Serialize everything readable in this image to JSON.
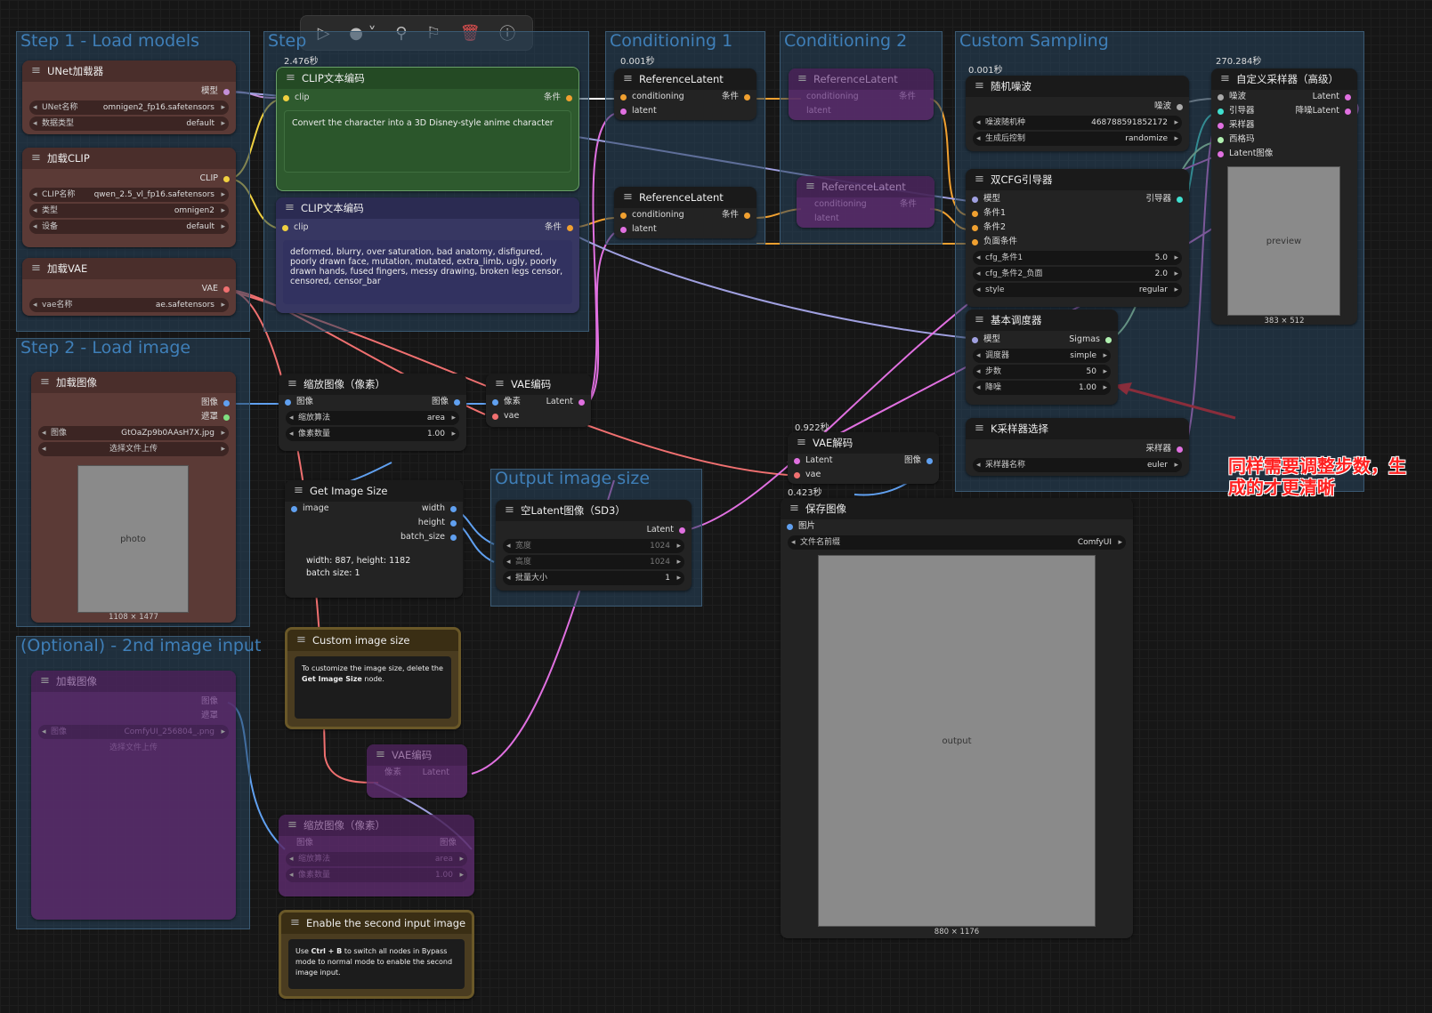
{
  "toolbar": {
    "play_icon": "play-icon",
    "record_icon": "record-icon",
    "link_icon": "link-icon",
    "pin_icon": "pin-icon",
    "delete_icon": "trash-icon",
    "help_icon": "help-icon",
    "delete_color": "#e05050"
  },
  "groups": {
    "step1": "Step 1 - Load models",
    "step": "Step",
    "cond1": "Conditioning 1",
    "cond2": "Conditioning 2",
    "custom": "Custom Sampling",
    "step2": "Step 2 - Load image",
    "output": "Output image size",
    "optional": "(Optional) - 2nd image input"
  },
  "times": {
    "clip1": "2.476秒",
    "cond1": "0.001秒",
    "noise": "0.001秒",
    "sampler": "270.284秒",
    "vaedec": "0.922秒",
    "save": "0.423秒"
  },
  "unet": {
    "title": "UNet加载器",
    "out": "模型",
    "w1_label": "UNet名称",
    "w1_value": "omnigen2_fp16.safetensors",
    "w2_label": "数据类型",
    "w2_value": "default"
  },
  "clip": {
    "title": "加载CLIP",
    "out": "CLIP",
    "w1_label": "CLIP名称",
    "w1_value": "qwen_2.5_vl_fp16.safetensors",
    "w2_label": "类型",
    "w2_value": "omnigen2",
    "w3_label": "设备",
    "w3_value": "default"
  },
  "vae": {
    "title": "加载VAE",
    "out": "VAE",
    "w1_label": "vae名称",
    "w1_value": "ae.safetensors"
  },
  "clipText1": {
    "title": "CLIP文本编码",
    "in": "clip",
    "out": "条件",
    "text": "Convert the character into a 3D Disney-style anime character"
  },
  "clipText2": {
    "title": "CLIP文本编码",
    "in": "clip",
    "out": "条件",
    "text": "deformed, blurry, over saturation, bad anatomy, disfigured, poorly drawn face, mutation, mutated, extra_limb, ugly, poorly drawn hands, fused fingers, messy drawing, broken legs censor, censored, censor_bar"
  },
  "ref1": {
    "title": "ReferenceLatent",
    "in1": "conditioning",
    "in2": "latent",
    "out": "条件"
  },
  "ref2": {
    "title": "ReferenceLatent",
    "in1": "conditioning",
    "in2": "latent",
    "out": "条件"
  },
  "ref3": {
    "title": "ReferenceLatent",
    "in1": "conditioning",
    "in2": "latent",
    "out": "条件"
  },
  "ref4": {
    "title": "ReferenceLatent",
    "in1": "conditioning",
    "in2": "latent",
    "out": "条件"
  },
  "noise": {
    "title": "随机噪波",
    "out": "噪波",
    "w1_label": "噪波随机种",
    "w1_value": "468788591852172",
    "w2_label": "生成后控制",
    "w2_value": "randomize"
  },
  "dualcfg": {
    "title": "双CFG引导器",
    "in1": "模型",
    "in2": "条件1",
    "in3": "条件2",
    "in4": "负面条件",
    "out": "引导器",
    "w1_label": "cfg_条件1",
    "w1_value": "5.0",
    "w2_label": "cfg_条件2_负面",
    "w2_value": "2.0",
    "w3_label": "style",
    "w3_value": "regular"
  },
  "sched": {
    "title": "基本调度器",
    "in": "模型",
    "out": "Sigmas",
    "w1_label": "调度器",
    "w1_value": "simple",
    "w2_label": "步数",
    "w2_value": "50",
    "w3_label": "降噪",
    "w3_value": "1.00"
  },
  "ksel": {
    "title": "K采样器选择",
    "out": "采样器",
    "w1_label": "采样器名称",
    "w1_value": "euler"
  },
  "sampler": {
    "title": "自定义采样器（高级）",
    "in1": "噪波",
    "in2": "引导器",
    "in3": "采样器",
    "in4": "西格玛",
    "in5": "Latent图像",
    "out1": "Latent",
    "out2": "降噪Latent",
    "caption": "383 × 512"
  },
  "loadimg": {
    "title": "加载图像",
    "out1": "图像",
    "out2": "遮罩",
    "w1_label": "图像",
    "w1_value": "GtOaZp9b0AAsH7X.jpg",
    "upload": "选择文件上传",
    "caption": "1108 × 1477"
  },
  "scale": {
    "title": "缩放图像（像素）",
    "in": "图像",
    "out": "图像",
    "w1_label": "缩放算法",
    "w1_value": "area",
    "w2_label": "像素数量",
    "w2_value": "1.00"
  },
  "vaeenc": {
    "title": "VAE编码",
    "in1": "像素",
    "in2": "vae",
    "out": "Latent"
  },
  "getsize": {
    "title": "Get Image Size",
    "in": "image",
    "out1": "width",
    "out2": "height",
    "out3": "batch_size",
    "info1": "width: 887, height: 1182",
    "info2": "batch size: 1"
  },
  "empty": {
    "title": "空Latent图像（SD3）",
    "out": "Latent",
    "w1_label": "宽度",
    "w1_value": "1024",
    "w2_label": "高度",
    "w2_value": "1024",
    "w3_label": "批量大小",
    "w3_value": "1"
  },
  "vaedec": {
    "title": "VAE解码",
    "in1": "Latent",
    "in2": "vae",
    "out": "图像"
  },
  "save": {
    "title": "保存图像",
    "in": "图片",
    "w1_label": "文件名前缀",
    "w1_value": "ComfyUI",
    "caption": "880 × 1176"
  },
  "customsize": {
    "title": "Custom image size",
    "text1": "To customize the image size, delete the",
    "text2": "Get Image Size",
    "text3": "node."
  },
  "enable2": {
    "title": "Enable the second input image",
    "text1": "Use",
    "text2": "Ctrl + B",
    "text3": "to switch all nodes in Bypass mode to normal mode to enable the second image input."
  },
  "optload": {
    "title": "加载图像",
    "out1": "图像",
    "out2": "遮罩",
    "w1_label": "图像",
    "w1_value": "ComfyUI_256804_.png",
    "upload": "选择文件上传"
  },
  "optvae": {
    "title": "VAE编码",
    "in": "像素",
    "out": "Latent"
  },
  "optscale": {
    "title": "缩放图像（像素）",
    "in": "图像",
    "out": "图像",
    "w1_label": "缩放算法",
    "w1_value": "area",
    "w2_label": "像素数量",
    "w2_value": "1.00"
  },
  "annotation": {
    "line1": "同样需要调整步数，生",
    "line2": "成的才更清晰",
    "color": "#ff2020"
  }
}
